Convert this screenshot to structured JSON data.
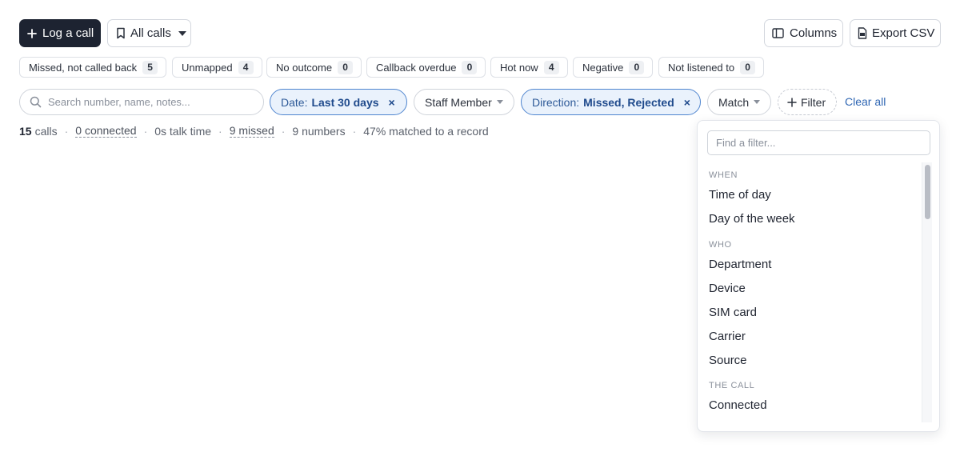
{
  "toolbar": {
    "log_call_label": "Log a call",
    "views_label": "All calls",
    "columns_label": "Columns",
    "export_label": "Export CSV"
  },
  "segments": [
    {
      "label": "Missed, not called back",
      "count": "5"
    },
    {
      "label": "Unmapped",
      "count": "4"
    },
    {
      "label": "No outcome",
      "count": "0"
    },
    {
      "label": "Callback overdue",
      "count": "0"
    },
    {
      "label": "Hot now",
      "count": "4"
    },
    {
      "label": "Negative",
      "count": "0"
    },
    {
      "label": "Not listened to",
      "count": "0"
    }
  ],
  "filters": {
    "search_placeholder": "Search number, name, notes...",
    "date": {
      "label": "Date:",
      "value": "Last 30 days"
    },
    "staff_label": "Staff Member",
    "direction": {
      "label": "Direction:",
      "value": "Missed, Rejected"
    },
    "match_label": "Match",
    "add_filter_label": "Filter",
    "clear_all_label": "Clear all",
    "remove_glyph": "×"
  },
  "summary": {
    "calls_count": "15",
    "calls_label": "calls",
    "connected": "0 connected",
    "talk_time": "0s talk time",
    "missed": "9 missed",
    "numbers": "9 numbers",
    "matched": "47% matched to a record",
    "separator": "·"
  },
  "filter_menu": {
    "search_placeholder": "Find a filter...",
    "groups": [
      {
        "heading": "WHEN",
        "items": [
          "Time of day",
          "Day of the week"
        ]
      },
      {
        "heading": "WHO",
        "items": [
          "Department",
          "Device",
          "SIM card",
          "Carrier",
          "Source"
        ]
      },
      {
        "heading": "THE CALL",
        "items": [
          "Connected"
        ]
      }
    ]
  },
  "icons": {
    "log_call": "plus-icon",
    "views": "bookmark-icon",
    "views_caret": "caret-down-icon",
    "columns": "columns-icon",
    "export": "csv-file-icon",
    "search": "search-icon",
    "add_filter": "plus-icon"
  },
  "colors": {
    "primary_button": "#1d2331",
    "active_filter_bg": "#eaf2fc",
    "active_filter_border": "#4f85cf",
    "link": "#2f66b3"
  }
}
